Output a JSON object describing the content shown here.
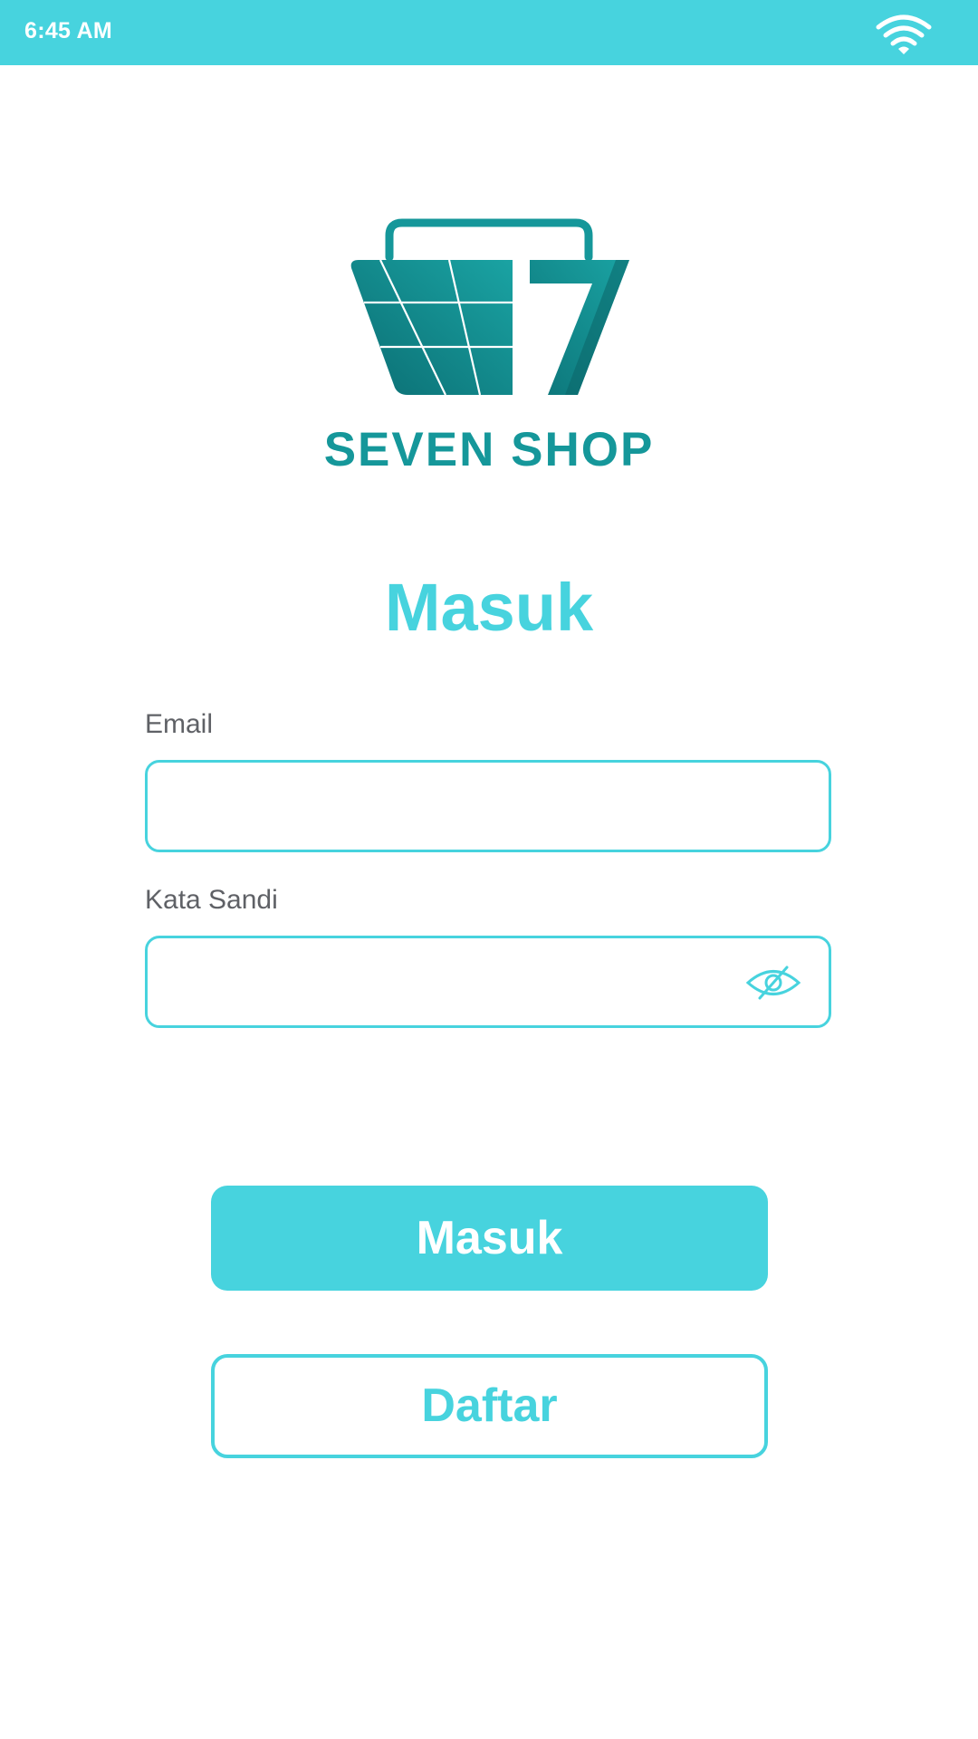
{
  "status_bar": {
    "time": "6:45 AM",
    "wifi_icon": "wifi-icon",
    "color": "#47d3de"
  },
  "brand": {
    "name": "SEVEN SHOP",
    "logo_icon": "shopping-basket-seven-icon",
    "color": "#15979a"
  },
  "login": {
    "title": "Masuk",
    "email_label": "Email",
    "email_value": "",
    "password_label": "Kata Sandi",
    "password_value": "",
    "password_toggle_icon": "eye-slash-icon",
    "submit_label": "Masuk",
    "register_label": "Daftar"
  },
  "colors": {
    "accent": "#47d3de",
    "brand_teal": "#15979a",
    "label_gray": "#5f6166",
    "background": "#ffffff"
  }
}
